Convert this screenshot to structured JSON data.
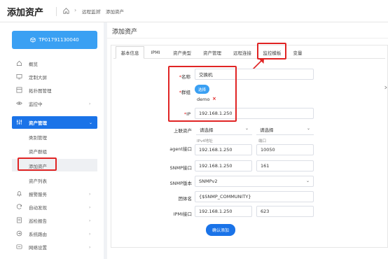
{
  "header": {
    "app_title": "添加资产",
    "breadcrumb": [
      "远程监测",
      "添加资产"
    ]
  },
  "sidebar": {
    "device_id": "TP01791130040",
    "items": [
      {
        "label": "概览",
        "icon": "home-icon"
      },
      {
        "label": "定制大屏",
        "icon": "monitor-icon"
      },
      {
        "label": "拓扑图管理",
        "icon": "topology-icon"
      },
      {
        "label": "监控中",
        "icon": "eye-icon"
      },
      {
        "label": "资产管理",
        "icon": "sliders-icon",
        "active": true
      },
      {
        "label": "报警服务",
        "icon": "bell-icon"
      },
      {
        "label": "自动发现",
        "icon": "sync-icon"
      },
      {
        "label": "巡检报告",
        "icon": "report-icon"
      },
      {
        "label": "系统路由",
        "icon": "route-icon"
      },
      {
        "label": "网络设置",
        "icon": "network-icon"
      }
    ],
    "sub_items": [
      "类别管理",
      "资产群组",
      "添加资产",
      "资产列表"
    ]
  },
  "main": {
    "title": "添加资产",
    "tabs": [
      "基本信息",
      "IPMI",
      "资产类型",
      "资产管理",
      "远程连接",
      "监控模板",
      "变量"
    ],
    "active_tab": "基本信息",
    "form": {
      "name_label": "名称",
      "name_value": "交换机",
      "group_label": "群组",
      "group_button": "选择",
      "group_value": "demo",
      "ip_label": "IP",
      "ip_value": "192.168.1.250",
      "upper_label": "上联资产",
      "upper_select_1": "请选择",
      "upper_select_2": "请选择",
      "agent_label": "agent接口",
      "agent_ip_hint": "IPv4地址",
      "agent_port_hint": "端口",
      "agent_ip": "192.168.1.250",
      "agent_port": "10050",
      "snmp_if_label": "SNMP接口",
      "snmp_ip": "192.168.1.250",
      "snmp_port": "161",
      "snmp_ver_label": "SNMP版本",
      "snmp_version": "SNMPv2",
      "community_label": "团体名",
      "community_value": "{$SNMP_COMMUNITY}",
      "ipmi_label": "IPMI接口",
      "ipmi_ip": "192.168.1.250",
      "ipmi_port": "623",
      "submit": "确认添加"
    }
  },
  "colors": {
    "primary": "#1a73e8",
    "accent": "#3aa0f3",
    "highlight": "#e02424"
  }
}
